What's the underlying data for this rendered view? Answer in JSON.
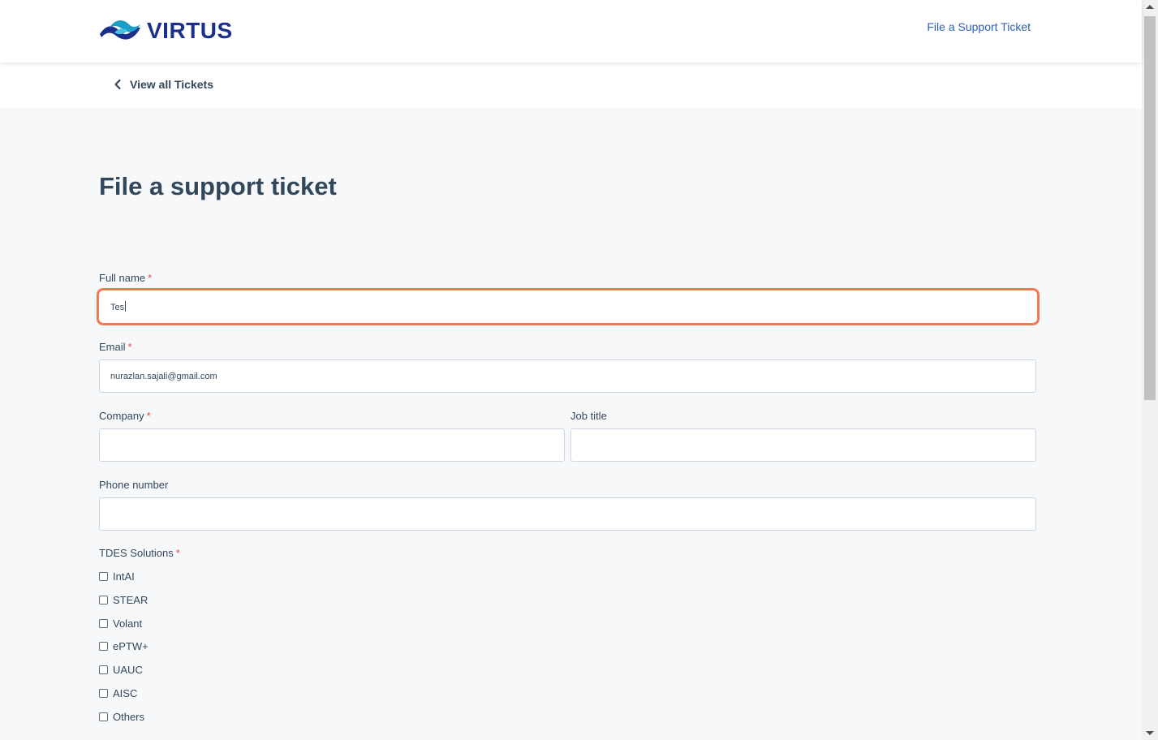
{
  "header": {
    "brand": "VIRTUS",
    "link_label": "File a Support Ticket"
  },
  "subnav": {
    "back_label": "View all Tickets"
  },
  "form": {
    "title": "File a support ticket",
    "required_marker": "*",
    "full_name": {
      "label": "Full name",
      "value": "Tes"
    },
    "email": {
      "label": "Email",
      "value": "nurazlan.sajali@gmail.com"
    },
    "company": {
      "label": "Company",
      "value": ""
    },
    "job_title": {
      "label": "Job title",
      "value": ""
    },
    "phone": {
      "label": "Phone number",
      "value": ""
    },
    "solutions": {
      "label": "TDES Solutions",
      "options": [
        {
          "label": "IntAI",
          "checked": false
        },
        {
          "label": "STEAR",
          "checked": false
        },
        {
          "label": "Volant",
          "checked": false
        },
        {
          "label": "ePTW+",
          "checked": false
        },
        {
          "label": "UAUC",
          "checked": false
        },
        {
          "label": "AISC",
          "checked": false
        },
        {
          "label": "Others",
          "checked": false
        }
      ]
    }
  },
  "colors": {
    "brand": "#1c2f8a",
    "focus_border": "#f07b52",
    "link": "#2f5fb3",
    "required": "#e64b4b"
  },
  "icons": {
    "logo": "virtus-logo-icon",
    "back": "chevron-left-icon"
  }
}
